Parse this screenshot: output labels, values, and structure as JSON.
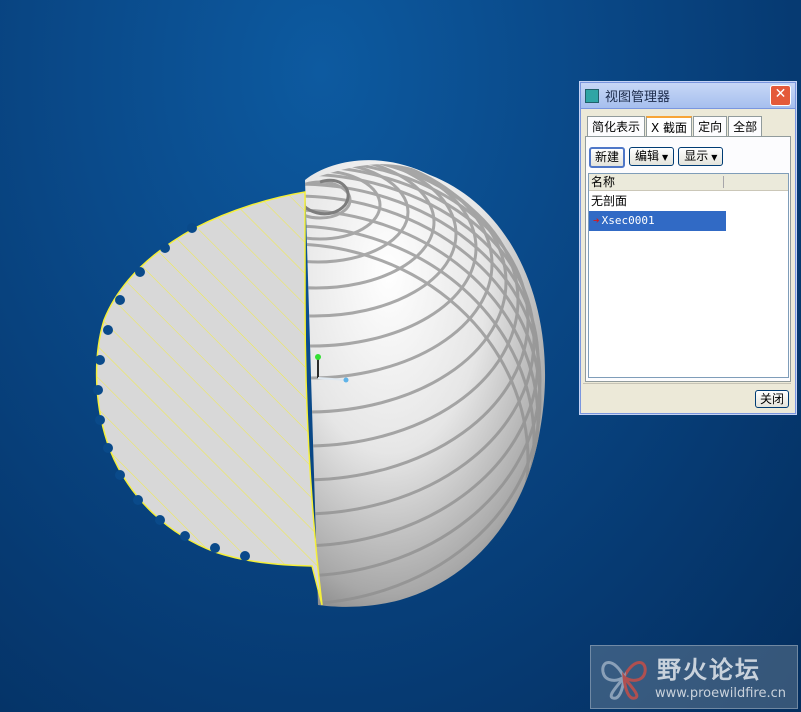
{
  "dialog": {
    "title": "视图管理器",
    "close_glyph": "✕",
    "tabs": [
      {
        "label": "简化表示"
      },
      {
        "label": "X 截面"
      },
      {
        "label": "定向"
      },
      {
        "label": "全部"
      }
    ],
    "active_tab": "X 截面",
    "buttons": {
      "new": "新建",
      "edit": "编辑",
      "display": "显示"
    },
    "list": {
      "column_header": "名称",
      "rows": [
        {
          "label": "无剖面",
          "selected": false
        },
        {
          "label": "Xsec0001",
          "selected": true
        }
      ]
    },
    "close_button": "关闭"
  },
  "watermark": {
    "title": "野火论坛",
    "url": "www.proewildfire.cn"
  },
  "colors": {
    "background": "#0a4a8a",
    "section_outline": "#f5ef3a",
    "selection": "#316ac5"
  }
}
